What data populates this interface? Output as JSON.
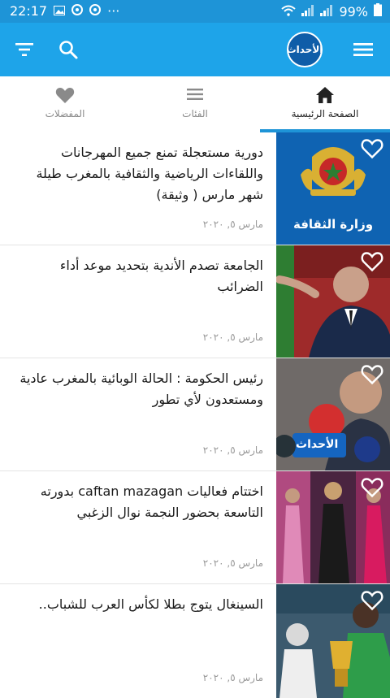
{
  "status_bar": {
    "time": "22:17",
    "dots": "···",
    "battery_percent": "99%",
    "icons": [
      "gallery-icon",
      "chrome-icon",
      "chrome-icon",
      "wifi-icon",
      "signal-icon",
      "signal-icon",
      "battery-icon"
    ]
  },
  "app_bar": {
    "logo_text": "الأحداث",
    "icons": [
      "menu-icon",
      "search-icon",
      "filter-icon"
    ],
    "color": "#1ea4e9"
  },
  "tabs": [
    {
      "label": "الصفحة الرئيسية",
      "icon": "home-icon",
      "active": true
    },
    {
      "label": "الفئات",
      "icon": "list-icon",
      "active": false
    },
    {
      "label": "المفضلات",
      "icon": "heart-icon",
      "active": false
    }
  ],
  "articles": [
    {
      "title": "دورية مستعجلة تمنع جميع المهرجانات واللقاءات الرياضية والثقافية بالمغرب طيلة شهر مارس ( وثيقة)",
      "date": "مارس ٥, ٢٠٢٠",
      "image_caption": "وزارة الثقافة"
    },
    {
      "title": "الجامعة تصدم الأندية بتحديد موعد أداء الضرائب",
      "date": "مارس ٥, ٢٠٢٠",
      "image_caption": ""
    },
    {
      "title": "رئيس الحكومة : الحالة الوبائية بالمغرب عادية ومستعدون لأي تطور",
      "date": "مارس ٥, ٢٠٢٠",
      "image_caption": "الأحداث"
    },
    {
      "title": "اختتام فعاليات caftan mazagan بدورته التاسعة بحضور النجمة نوال الزغبي",
      "date": "مارس ٥, ٢٠٢٠",
      "image_caption": ""
    },
    {
      "title": "السينغال يتوج بطلا لكأس العرب للشباب..",
      "date": "مارس ٥, ٢٠٢٠",
      "image_caption": ""
    }
  ]
}
